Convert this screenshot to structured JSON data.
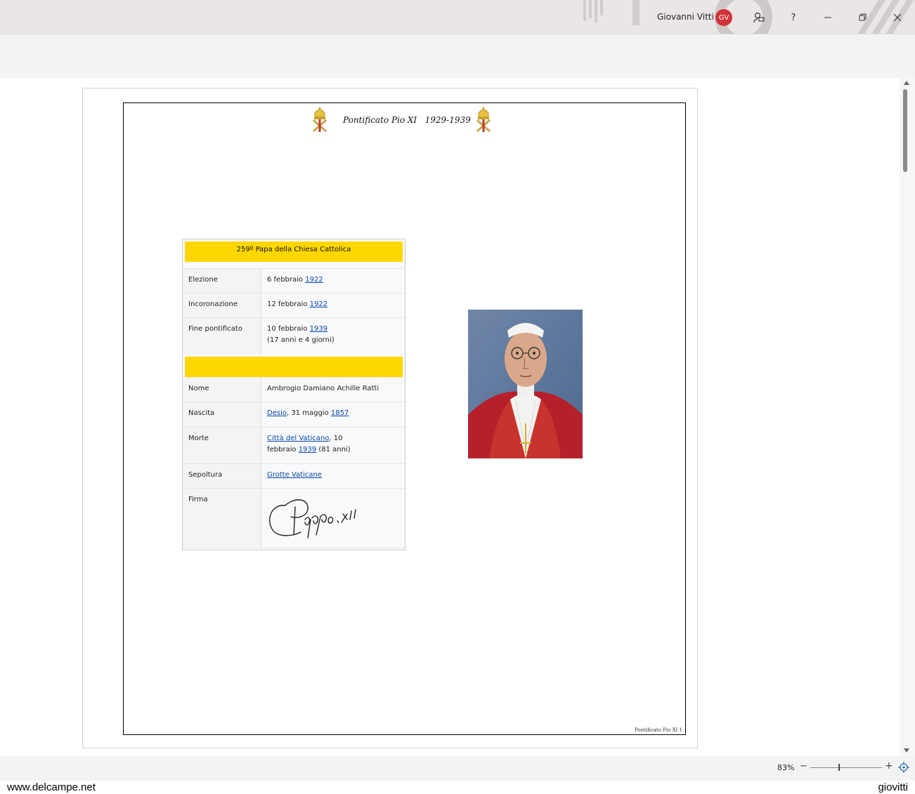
{
  "titlebar": {
    "user_name": "Giovanni Vitti",
    "avatar_initials": "GV",
    "help_label": "?"
  },
  "document": {
    "header_title": "Pontificato Pio XI   1929-1939",
    "footer_text": "Pontificato Pio XI 1",
    "infobox": {
      "heading": "259º Papa della Chiesa Cattolica",
      "rows_top": [
        {
          "label": "Elezione",
          "value_text": "6 febbraio ",
          "value_link": "1922",
          "value_after": ""
        },
        {
          "label": "Incoronazione",
          "value_text": "12 febbraio ",
          "value_link": "1922",
          "value_after": ""
        },
        {
          "label": "Fine pontificato",
          "value_text": "10 febbraio ",
          "value_link": "1939",
          "value_line2": "(17 anni e 4 giorni)"
        }
      ],
      "nome": {
        "label": "Nome",
        "value": "Ambrogio Damiano Achille Ratti"
      },
      "nascita": {
        "label": "Nascita",
        "link1": "Desio",
        "text": ", 31 maggio ",
        "link2": "1857"
      },
      "morte": {
        "label": "Morte",
        "link1": "Città del Vaticano",
        "text1": ", 10",
        "line2_text": "febbraio ",
        "link2": "1939",
        "text2": " (81 anni)"
      },
      "sepoltura": {
        "label": "Sepoltura",
        "link": "Grotte Vaticane"
      },
      "firma": {
        "label": "Firma"
      }
    }
  },
  "statusbar": {
    "zoom": "83%",
    "zoom_out": "−",
    "zoom_in": "+"
  },
  "watermark": {
    "left": "www.delcampe.net",
    "right": "giovitti"
  },
  "colors": {
    "infobox_header": "#ffd700",
    "link": "#0645ad",
    "avatar": "#d13438"
  },
  "icons": [
    "comment-icon",
    "help-icon",
    "minimize-icon",
    "restore-icon",
    "close-icon",
    "papal-emblem-icon",
    "zoom-fit-icon"
  ]
}
